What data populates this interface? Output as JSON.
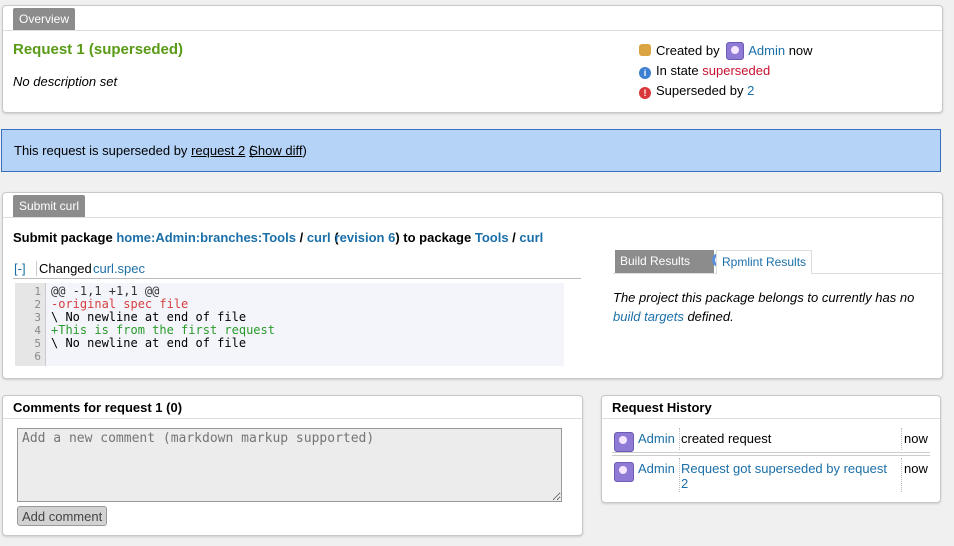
{
  "overview": {
    "tab_label": "Overview",
    "title": "Request 1 (superseded)",
    "description": "No description set",
    "created_by_label": "Created by",
    "creator": "Admin",
    "created_when": "now",
    "state_label": "In state",
    "state_value": "superseded",
    "superseded_by_label": "Superseded by",
    "superseded_by_value": "2"
  },
  "notice": {
    "prefix": "This request is superseded by",
    "request_link": "request 2",
    "open_paren": "(",
    "show_diff_link": "Show diff",
    "close_paren": ")"
  },
  "submit": {
    "tab_label": "Submit curl",
    "heading_prefix": "Submit package",
    "source_project": "home:Admin:branches:Tools",
    "slash1": "/",
    "source_package": "curl",
    "rev_open": "(",
    "revision_link": "revision 6",
    "rev_close": ")",
    "to_package": "to package",
    "target_project": "Tools",
    "slash2": "/",
    "target_package": "curl",
    "toggle": "[-]",
    "changed_label": "Changed",
    "changed_file": "curl.spec",
    "diff_lines": [
      {
        "num": "1",
        "text": "@@ -1,1 +1,1 @@",
        "kind": "hunk"
      },
      {
        "num": "2",
        "text": "-original spec file",
        "kind": "del"
      },
      {
        "num": "3",
        "text": "\\ No newline at end of file",
        "kind": "ctx"
      },
      {
        "num": "4",
        "text": "+This is from the first request",
        "kind": "add"
      },
      {
        "num": "5",
        "text": "\\ No newline at end of file",
        "kind": "ctx"
      },
      {
        "num": "6",
        "text": "",
        "kind": "ctx"
      }
    ],
    "build_results_tab": "Build Results",
    "rpmlint_tab": "Rpmlint Results",
    "build_msg_1": "The project this package belongs to currently has no",
    "build_targets_link": "build targets",
    "build_msg_2": "defined."
  },
  "comments": {
    "title": "Comments for request 1 (0)",
    "placeholder": "Add a new comment (markdown markup supported)",
    "button_label": "Add comment"
  },
  "history": {
    "title": "Request History",
    "rows": [
      {
        "user": "Admin",
        "action": "created request",
        "action_is_link": false,
        "when": "now"
      },
      {
        "user": "Admin",
        "action": "Request got superseded by request 2",
        "action_is_link": true,
        "when": "now"
      }
    ]
  },
  "colors": {
    "title_green": "#5a9a17",
    "state_red": "#c8102e",
    "notice_bg": "#b5d3f7",
    "notice_border": "#3a6fbd",
    "link_blue": "#1b6fa8"
  }
}
